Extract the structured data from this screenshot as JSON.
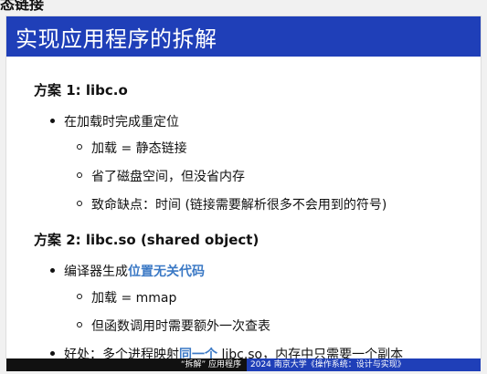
{
  "partial_top_text": "态链接",
  "slide": {
    "title": "实现应用程序的拆解",
    "sections": [
      {
        "heading": "方案 1: libc.o",
        "items": [
          {
            "text": "在加载时完成重定位",
            "subitems": [
              "加载 = 静态链接",
              "省了磁盘空间，但没省内存",
              "致命缺点：时间 (链接需要解析很多不会用到的符号)"
            ]
          }
        ]
      },
      {
        "heading": "方案 2: libc.so (shared object)",
        "items": [
          {
            "prefix": "编译器生成",
            "highlight": "位置无关代码",
            "suffix": "",
            "subitems": [
              "加载 = mmap",
              "但函数调用时需要额外一次查表"
            ]
          },
          {
            "prefix": "好处：多个进程映射",
            "highlight": "同一个",
            "suffix": " libc.so，内存中只需要一个副本"
          }
        ]
      }
    ]
  },
  "footer": {
    "left": "“拆解” 应用程序",
    "right": "2024 南京大学《操作系统：设计与实现》"
  },
  "colors": {
    "title_bar": "#1f3fb8",
    "highlight": "#3b79c5",
    "footer_left": "#111111",
    "footer_right": "#1f3fb8"
  }
}
